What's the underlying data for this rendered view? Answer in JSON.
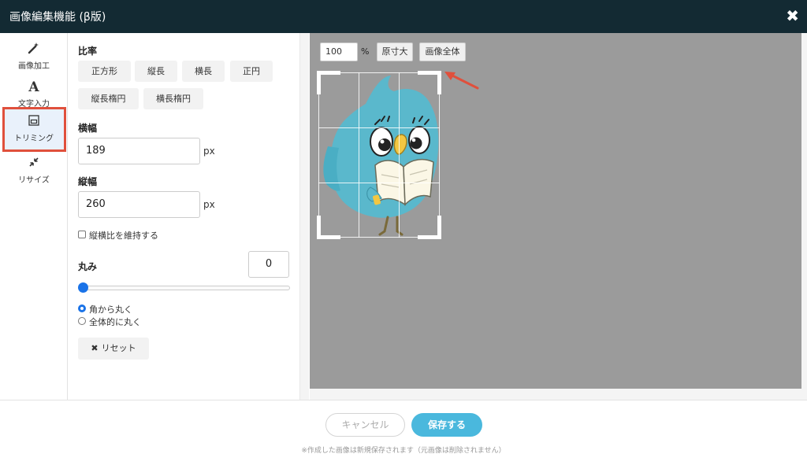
{
  "window": {
    "title": "画像編集機能 (β版)",
    "close_glyph": "✖"
  },
  "nav": {
    "items": [
      {
        "label": "画像加工",
        "icon": "magic-wand-icon",
        "glyph": "✎"
      },
      {
        "label": "文字入力",
        "icon": "text-a-icon",
        "glyph": "A"
      },
      {
        "label": "トリミング",
        "icon": "crop-icon",
        "glyph": "⊡",
        "active": true
      },
      {
        "label": "リサイズ",
        "icon": "resize-arrows-icon",
        "glyph": "⤡"
      }
    ],
    "highlight_color": "#e0503c"
  },
  "panel": {
    "ratio": {
      "label": "比率",
      "options": [
        "正方形",
        "縦長",
        "横長",
        "正円",
        "縦長楕円",
        "横長楕円"
      ]
    },
    "width": {
      "label": "横幅",
      "value": "189",
      "unit": "px"
    },
    "height": {
      "label": "縦幅",
      "value": "260",
      "unit": "px"
    },
    "keep_ratio": {
      "label": "縦横比を維持する",
      "checked": false
    },
    "rounding": {
      "label": "丸み",
      "value": "0",
      "slider_value": 0,
      "options": [
        {
          "label": "角から丸く",
          "checked": true
        },
        {
          "label": "全体的に丸く",
          "checked": false
        }
      ]
    },
    "reset_label": "リセット",
    "reset_glyph": "✖"
  },
  "canvas": {
    "zoom_value": "100",
    "zoom_unit": "%",
    "original_size_label": "原寸大",
    "fit_image_label": "画像全体",
    "background_color": "#9b9b9b",
    "annotation_arrow_color": "#e0503c"
  },
  "footer": {
    "cancel_label": "キャンセル",
    "save_label": "保存する",
    "note": "※作成した画像は新規保存されます（元画像は削除されません）",
    "accent_color": "#4ab8dd"
  }
}
